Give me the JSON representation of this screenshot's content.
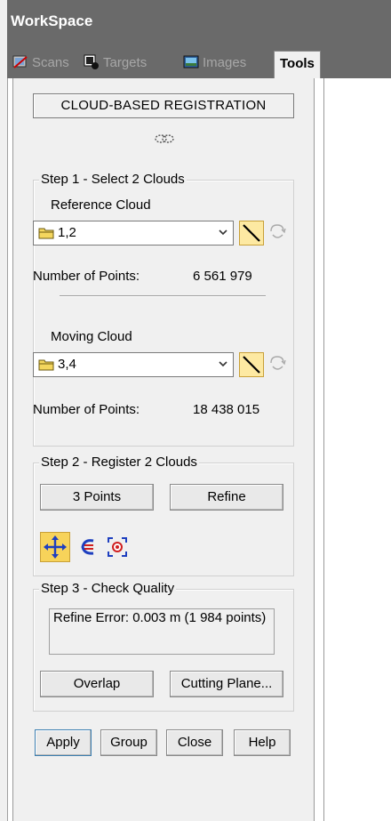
{
  "window": {
    "title": "WorkSpace"
  },
  "tabs": [
    {
      "label": "Scans",
      "icon": "scans-icon",
      "active": false
    },
    {
      "label": "Targets",
      "icon": "targets-icon",
      "active": false
    },
    {
      "label": "Images",
      "icon": "images-icon",
      "active": false
    },
    {
      "label": "Tools",
      "active": true
    }
  ],
  "panel": {
    "title": "CLOUD-BASED REGISTRATION",
    "link_icon": "link-clouds-icon",
    "step1": {
      "title": "Step 1 - Select 2 Clouds",
      "reference": {
        "label": "Reference Cloud",
        "value": "1,2",
        "points_label": "Number of Points:",
        "points_value": "6 561 979"
      },
      "moving": {
        "label": "Moving Cloud",
        "value": "3,4",
        "points_label": "Number of Points:",
        "points_value": "18 438 015"
      }
    },
    "step2": {
      "title": "Step 2 - Register 2 Clouds",
      "three_points_label": "3 Points",
      "refine_label": "Refine"
    },
    "step3": {
      "title": "Step 3 - Check Quality",
      "error_text": "Refine Error: 0.003 m (1 984 points)",
      "overlap_label": "Overlap",
      "cutting_plane_label": "Cutting Plane..."
    },
    "footer": {
      "apply": "Apply",
      "group": "Group",
      "close": "Close",
      "help": "Help"
    }
  },
  "colors": {
    "titlebar": "#6a6a6a",
    "panel_bg": "#f0f0f0",
    "highlight": "#fde9a2"
  }
}
